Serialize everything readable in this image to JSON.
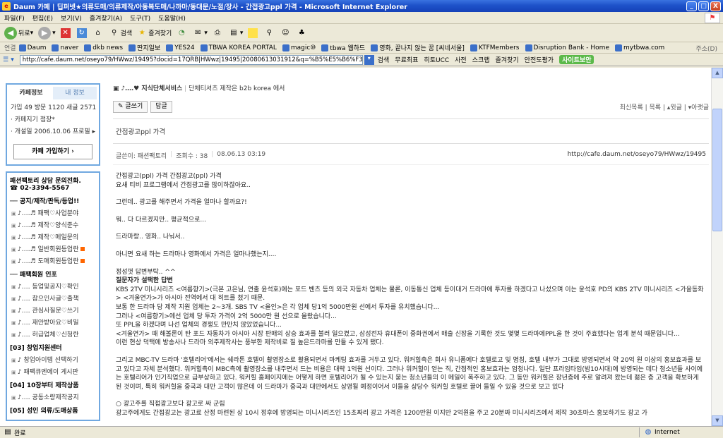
{
  "window": {
    "title": "Daum 카페 | 딥퍼넷★의류도매/의류제작/아동복도매/나까마/동대문/노점/장사 - 간접광고ppl 가격 - Microsoft Internet Explorer",
    "min": "_",
    "max": "□",
    "close": "X"
  },
  "menu": [
    "파일(F)",
    "편집(E)",
    "보기(V)",
    "즐겨찾기(A)",
    "도구(T)",
    "도움말(H)"
  ],
  "toolbar": {
    "back": "뒤로",
    "search": "검색",
    "favorites": "즐겨찾기"
  },
  "links": {
    "label": "연결",
    "items": [
      "Daum",
      "naver",
      "dkb news",
      "딴지일보",
      "YES24",
      "TBWA KOREA PORTAL",
      "magic⑩",
      "tbwa 웹하드",
      "영화, 끝나지 않는 꿈 [씨네서울]",
      "KTFMembers",
      "Disruption Bank - Home",
      "mytbwa.com"
    ],
    "extra": "주소(D)"
  },
  "address": {
    "url": "http://cafe.daum.net/oseyo79/HWwz/19495?docid=17QRB|HWwz|19495|20080613031912&q=%B5%E5%B6%F3%B8%",
    "items": [
      "검색",
      "무료최표",
      "히토UCC",
      "사전",
      "스크랩",
      "즐겨찾기",
      "안전도평가",
      "사이트보안"
    ]
  },
  "sidebar": {
    "tab_info": "카페정보",
    "tab_mine": "내 정보",
    "stats": "가입 49   방문 1120   새글 2571",
    "manager": "· 카페지기  점장*",
    "opened": "· 개설일        2006.10.06   프로필 ▸",
    "join": "카페 가입하기  ›",
    "contact": "패션팩토리 상담 문의전화.",
    "phone": "☎ 02-3394-5567",
    "sections": [
      {
        "title": "── 공지/제작/판독/등업!!",
        "items": [
          "♪‥‥♬ 패팩♡사업분야",
          "♪‥‥♬ 제작♡양식준수",
          "♪‥‥♬ 제작♡메일문의",
          "♪‥‥♬ 일반회원등업란",
          "♪‥‥♬ 도매회원등업란"
        ]
      },
      {
        "title": "── 패팩회원 인포",
        "items": [
          "♪‥‥ 등업및공지♡확인",
          "♪‥‥ 참으인사글♡출책",
          "♪‥‥ 관심사질문♡쓰기",
          "♪‥‥ 재안받아요♡비밀",
          "♪‥‥ 허급업체♡신청란"
        ]
      },
      {
        "title": "[03] 창업지원센터",
        "items": [
          "♪ 창업아이템 선택하기",
          "♪ 패팩큐엔에이 게시판"
        ]
      },
      {
        "title": "[04] 10장부터 제작상품",
        "items": [
          "♪‥‥ 공동소량제작공지"
        ]
      },
      {
        "title": "[05] 성인 의류/도매상품",
        "items": []
      }
    ]
  },
  "post": {
    "breadcrumb": "♪‥‥♥ 지식단체서비스",
    "breadcrumb_sub": "단체티셔츠 제작은 b2b korea 에서",
    "write": "✎ 글쓰기",
    "reply": "답글",
    "nav": "최신목록 | 목록 | ▴윗글 | ▾아랫글",
    "title": "간접광고ppl 가격",
    "author": "글쓴이: 패션팩토리",
    "views": "조회수 : 38",
    "date": "08.06.13 03:19",
    "url": "http://cafe.daum.net/oseyo79/HWwz/19495",
    "paras": [
      [
        "간접광고(ppl) 가격 간접광고(ppl) 가격",
        "요새 티비 프로그램에서 간접광고를 많이하잖아요.."
      ],
      [
        "그런데.. 광고를 해주면서 가격을 얼마나 할까요?!"
      ],
      [
        "뭐.. 다 다르겠지만.. 평균적으로..."
      ],
      [
        "드라마랑.. 영화.. 나눠서.."
      ],
      [
        "아니면 요새 하는 드라마나 영화에서 가격은 얼마나했는지...."
      ],
      [
        "정성껏 답변부탁.. ^^",
        "질문자가 설택한 답변",
        "KBS 2TV 미니시리즈 <여름향기>(극본 고은님, 연출 윤석호)에는 포드 벤츠 등의 외국 자동차 업체는 물론, 이동통신 업체 등이대거 드라마에 투자를 하겠다고 나섰으며 이는 윤석호 PD의 KBS 2TV 미니시리즈 <가을동화> <겨울연가>가 아시아 전역에서 대 히트를 쳤기 때문.",
        "보통 한 드라마 당 제작 지원 업체는 2~3개. SBS TV <올인>은 각 업체 당1억 5000만원 선에서 투자를 유치했습니다...",
        "그러나 <여름향기>에선 업체 당 투자 가격이 2억 5000만 원 선으로 올랐습니다...",
        "또 PPL을 하겠다며 나선 업체의 경쟁도 만만치 않았었습니다...",
        "<겨울연가> 때 해볼론이 탄 포드 자동차가 아시아 시장 판매의 상승 효과를 불러 일으켰고, 삼성전자 휴대폰이 중화권에서 매출 신장을 기록한 것도 몇몇 드라마에PPL을 한 것이 주효했다는 업계 분석 때문입니다...",
        "이런 현상 덕택에 방송사나 드라마 외주제작사는 풍부한 제작비로 질 높은드라마를 만들 수 있게 됐다."
      ],
      [
        "그리고 MBC-TV 드라마 '호텔리어'에서는 쉐라톤 호텔이 촬영장소로 활용되면서 마케팅 효과를 거두고 있다. 워커힐측은 회사 유니폼에다 호텔로고 및 명칭, 호텔 내부가 그대로 방영되면서 약 20억 원 이상의 홍보효과를 보고 있다고 자체 분석했다. 워커힐측이 MBC측에 촬영장소를 내주면서 드는 비용은 대략 1억원 선이다. 그러나 워커힐이 얻는 직, 간접적인 홍보효과는 엄청나다. 일단 프라임타임(밤10시대)에 방영되는 데다 청소년들 사이에는 호텔리어가 인기직업으로 급부상하고 있다. 워커힐 홈페이지에는 어떻게 하면 호텔리어가 될 수 있는지 묻는 청소년들의 이 메일이 폭주하고 있다. 그 동안 워커힐은 장년층에 주로 알려져 왔는데 젊은 층 고객을 확보하게 된 것이며, 특히 워커힐을 중국과 대만 고객이 많은데 이 드라마가 중국과 대만에서도 상영될 예정이어서 이들을 상당수 워커힐 호텔로 끌어 들일 수 있을 것으로 보고 있다"
      ],
      [
        "○ 광고주를 직접광고보다 광고로 싸 군림",
        "광고주에게도 간접광고는 광고료 산정 마련된 상 10시 정후에 방영되는 미니시리즈인 15초짜리 광고 가격은 1200만원 이지만 2억원을 주고 20분짜 미니시리즈에서 제작 30초마스 홍보하기도 광고 가"
      ]
    ]
  },
  "statusbar": {
    "left": "완료",
    "zone": "Internet"
  }
}
